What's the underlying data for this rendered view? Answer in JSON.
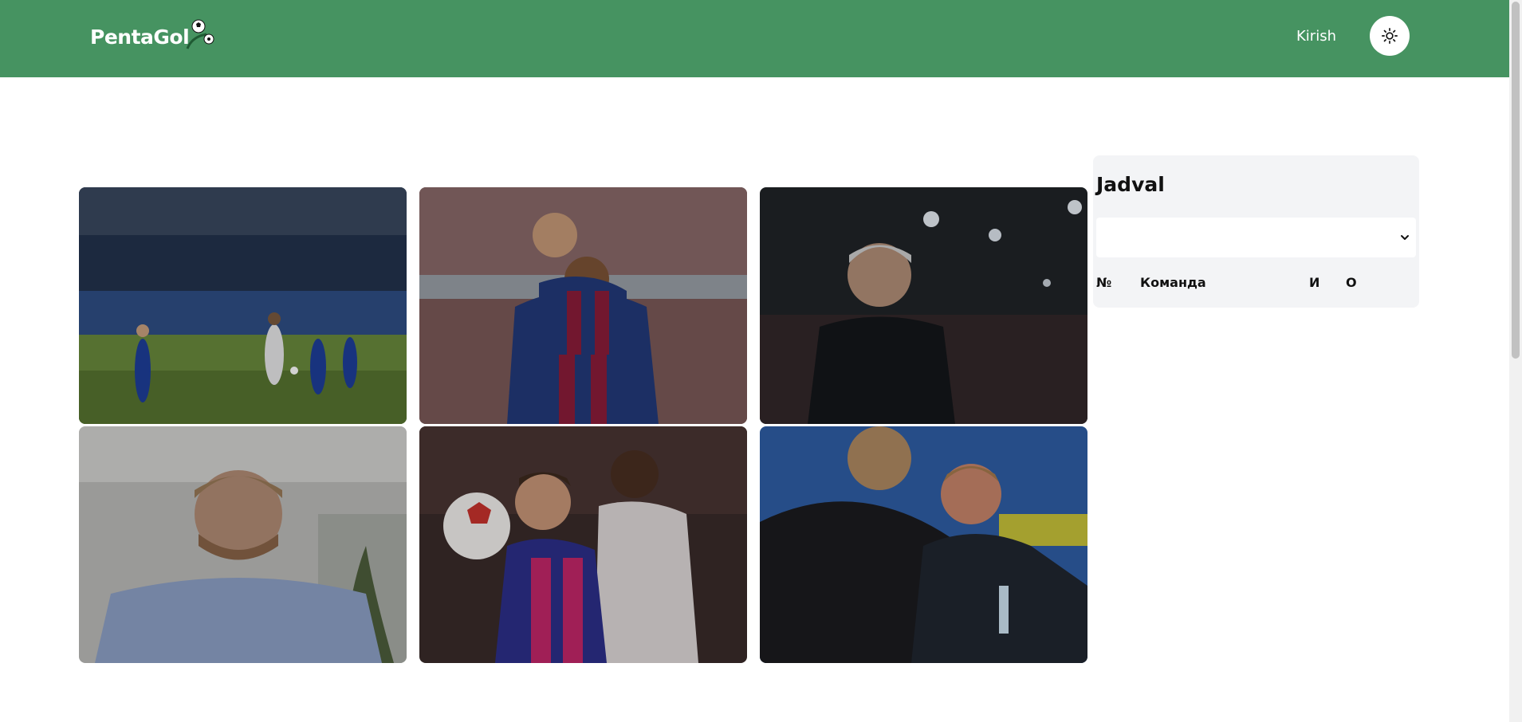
{
  "header": {
    "logo_text": "PentaGol",
    "login_label": "Kirish",
    "theme_toggle_icon": "sun-icon",
    "background_color": "#469361"
  },
  "news": {
    "images": [
      {
        "subject": "match-action-photo"
      },
      {
        "subject": "barcelona-players-celebration-photo"
      },
      {
        "subject": "coach-portrait-photo"
      },
      {
        "subject": "zenit-coach-portrait-photo"
      },
      {
        "subject": "barcelona-bayern-match-photo"
      },
      {
        "subject": "coaches-handshake-photo"
      }
    ]
  },
  "standings": {
    "title": "Jadval",
    "league_select_value": "",
    "columns": {
      "number": "№",
      "team": "Команда",
      "played": "И",
      "points": "О"
    }
  }
}
